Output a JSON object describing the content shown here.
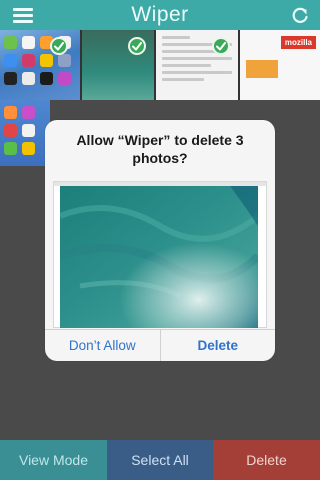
{
  "header": {
    "title": "Wiper",
    "menu_icon": "menu-icon",
    "refresh_icon": "refresh-icon"
  },
  "thumbnails": {
    "mozilla_label": "mozilla"
  },
  "dialog": {
    "message": "Allow “Wiper” to delete 3 photos?",
    "dont_allow": "Don’t Allow",
    "delete": "Delete"
  },
  "toolbar": {
    "view_mode": "View Mode",
    "select_all": "Select All",
    "delete": "Delete"
  },
  "colors": {
    "header": "#3eaaa7",
    "check": "#3aa95a",
    "link": "#2f73cc",
    "view_mode_bg": "#3a8f95",
    "select_all_bg": "#3a5d87",
    "delete_bg": "#a43f37"
  }
}
